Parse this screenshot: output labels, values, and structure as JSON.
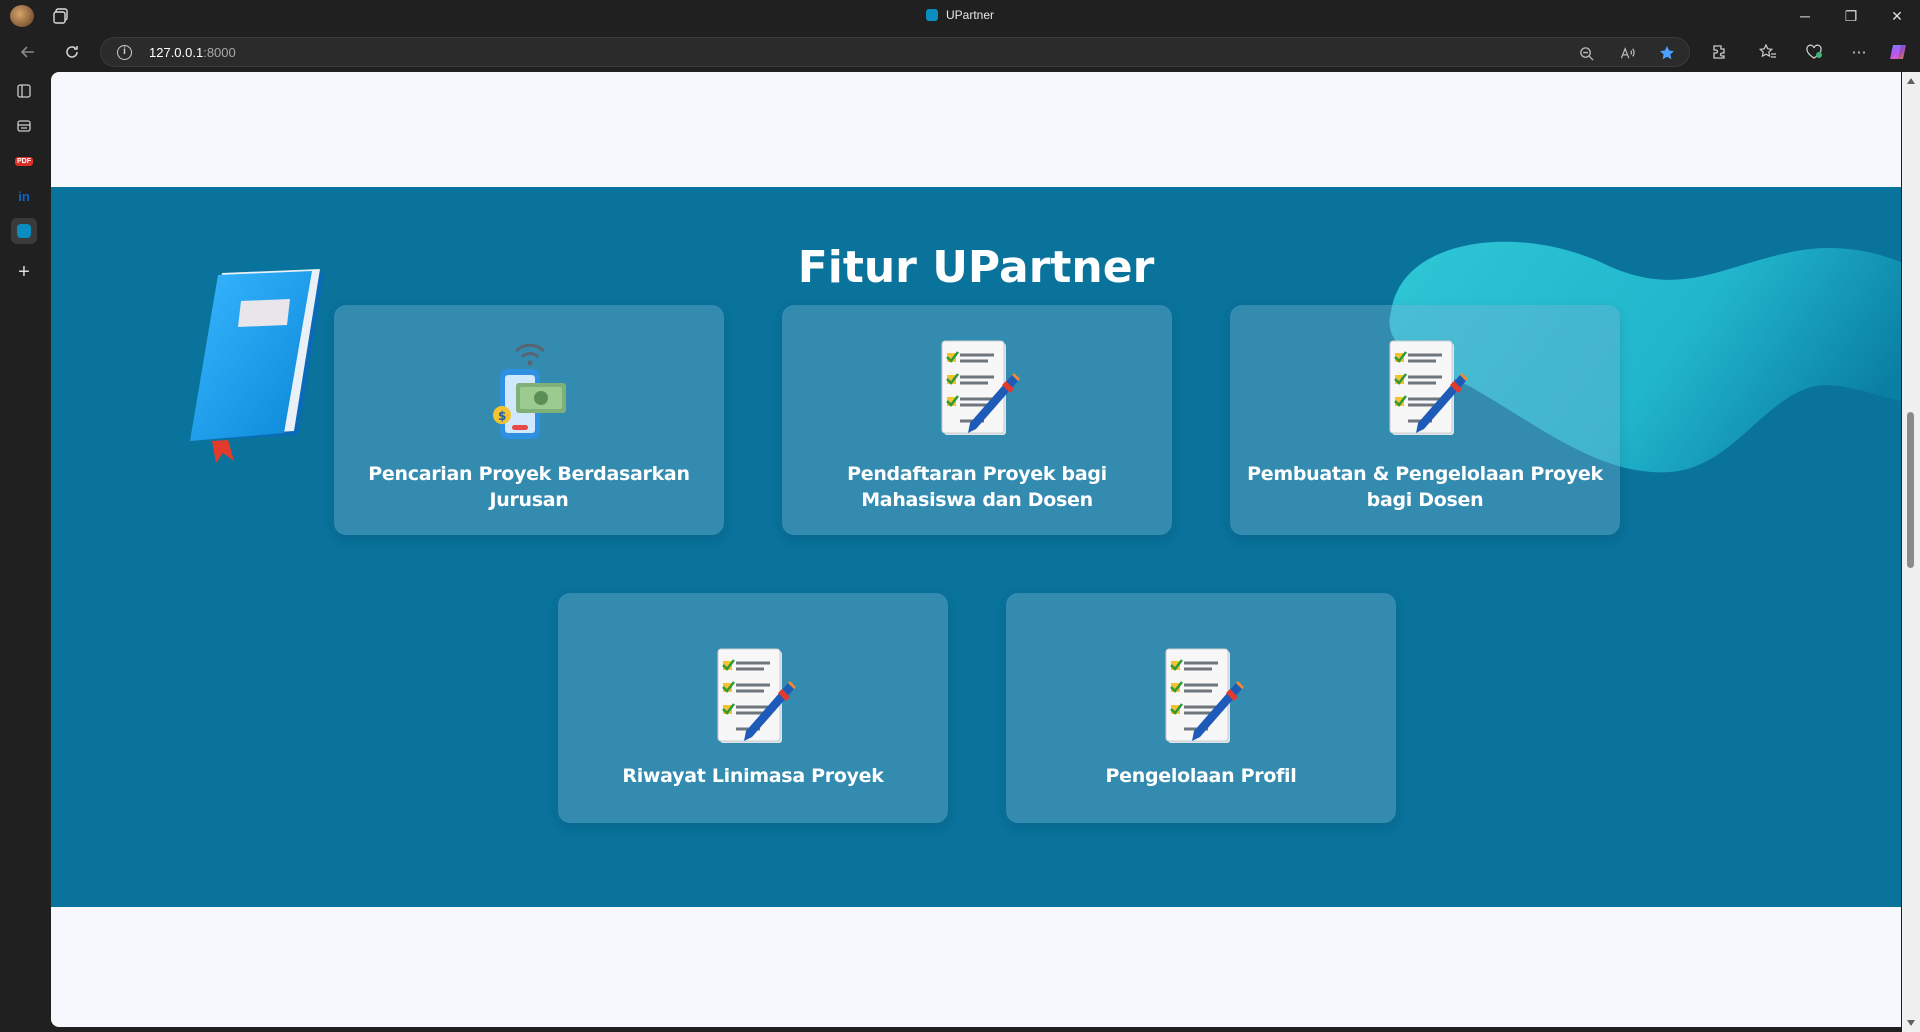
{
  "browser": {
    "tab_title": "UPartner",
    "url_host": "127.0.0.1",
    "url_port": ":8000",
    "window_controls": {
      "minimize": "─",
      "restore": "❐",
      "close": "✕"
    }
  },
  "sidebar": {
    "items": [
      {
        "icon": "collections-icon"
      },
      {
        "icon": "reading-list-icon"
      },
      {
        "icon": "pdf-icon",
        "label": "PDF"
      },
      {
        "icon": "linkedin-icon",
        "label": "in"
      },
      {
        "icon": "upartner-icon"
      },
      {
        "icon": "add-icon",
        "label": "+"
      }
    ]
  },
  "page": {
    "section_title": "Fitur UPartner",
    "features": [
      {
        "label": "Pencarian Proyek Berdasarkan Jurusan",
        "icon": "mobile-payment-icon"
      },
      {
        "label": "Pendaftaran Proyek bagi Mahasiswa dan Dosen",
        "icon": "checklist-pen-icon"
      },
      {
        "label": "Pembuatan & Pengelolaan Proyek bagi Dosen",
        "icon": "checklist-pen-icon"
      },
      {
        "label": "Riwayat Linimasa Proyek",
        "icon": "checklist-pen-icon"
      },
      {
        "label": "Pengelolaan Profil",
        "icon": "checklist-pen-icon"
      }
    ]
  },
  "colors": {
    "section_bg": "#09739c",
    "page_bg": "#f6f8fd",
    "accent_blob": "#2ec7d6"
  }
}
